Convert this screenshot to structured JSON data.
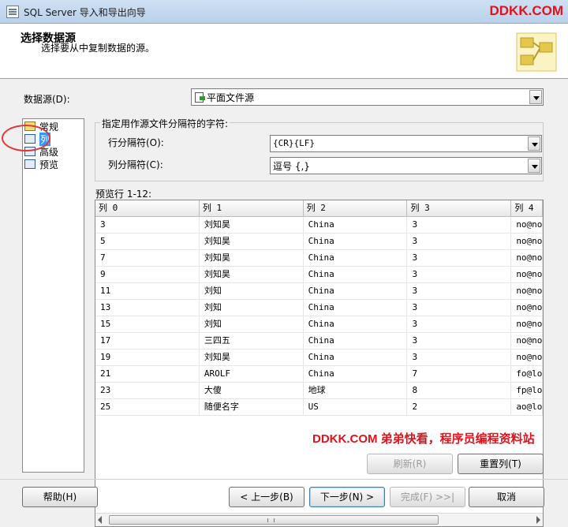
{
  "window": {
    "title": "SQL Server 导入和导出向导",
    "watermark": "DDKK.COM"
  },
  "header": {
    "title": "选择数据源",
    "subtitle": "选择要从中复制数据的源。"
  },
  "datasource": {
    "label": "数据源(D):",
    "value": "平面文件源"
  },
  "nav": {
    "items": [
      {
        "label": "常规"
      },
      {
        "label": "列",
        "selected": true
      },
      {
        "label": "高级"
      },
      {
        "label": "预览"
      }
    ]
  },
  "delimiters": {
    "legend": "指定用作源文件分隔符的字符:",
    "row_label": "行分隔符(O):",
    "row_value": "{CR}{LF}",
    "col_label": "列分隔符(C):",
    "col_value": "逗号 {,}"
  },
  "preview": {
    "label": "预览行 1-12:",
    "columns": [
      "列 0",
      "列 1",
      "列 2",
      "列 3",
      "列 4"
    ],
    "rows": [
      [
        "3",
        "刘知昊",
        "China",
        "3",
        "no@no"
      ],
      [
        "5",
        "刘知昊",
        "China",
        "3",
        "no@no"
      ],
      [
        "7",
        "刘知昊",
        "China",
        "3",
        "no@no"
      ],
      [
        "9",
        "刘知昊",
        "China",
        "3",
        "no@no"
      ],
      [
        "11",
        "刘知",
        "China",
        "3",
        "no@no"
      ],
      [
        "13",
        "刘知",
        "China",
        "3",
        "no@no"
      ],
      [
        "15",
        "刘知",
        "China",
        "3",
        "no@no"
      ],
      [
        "17",
        "三四五",
        "China",
        "3",
        "no@no"
      ],
      [
        "19",
        "刘知昊",
        "China",
        "3",
        "no@no"
      ],
      [
        "21",
        "AROLF",
        "China",
        "7",
        "fo@lo"
      ],
      [
        "23",
        "大傻",
        "地球",
        "8",
        "fp@lo"
      ],
      [
        "25",
        "随便名字",
        "US",
        "2",
        "ao@lo"
      ]
    ]
  },
  "buttons": {
    "refresh": "刷新(R)",
    "reset_columns": "重置列(T)",
    "help": "帮助(H)",
    "back": "< 上一步(B)",
    "next": "下一步(N) >",
    "finish": "完成(F) >>|",
    "cancel": "取消"
  },
  "footer_watermark": "DDKK.COM 弟弟快看，程序员编程资料站"
}
